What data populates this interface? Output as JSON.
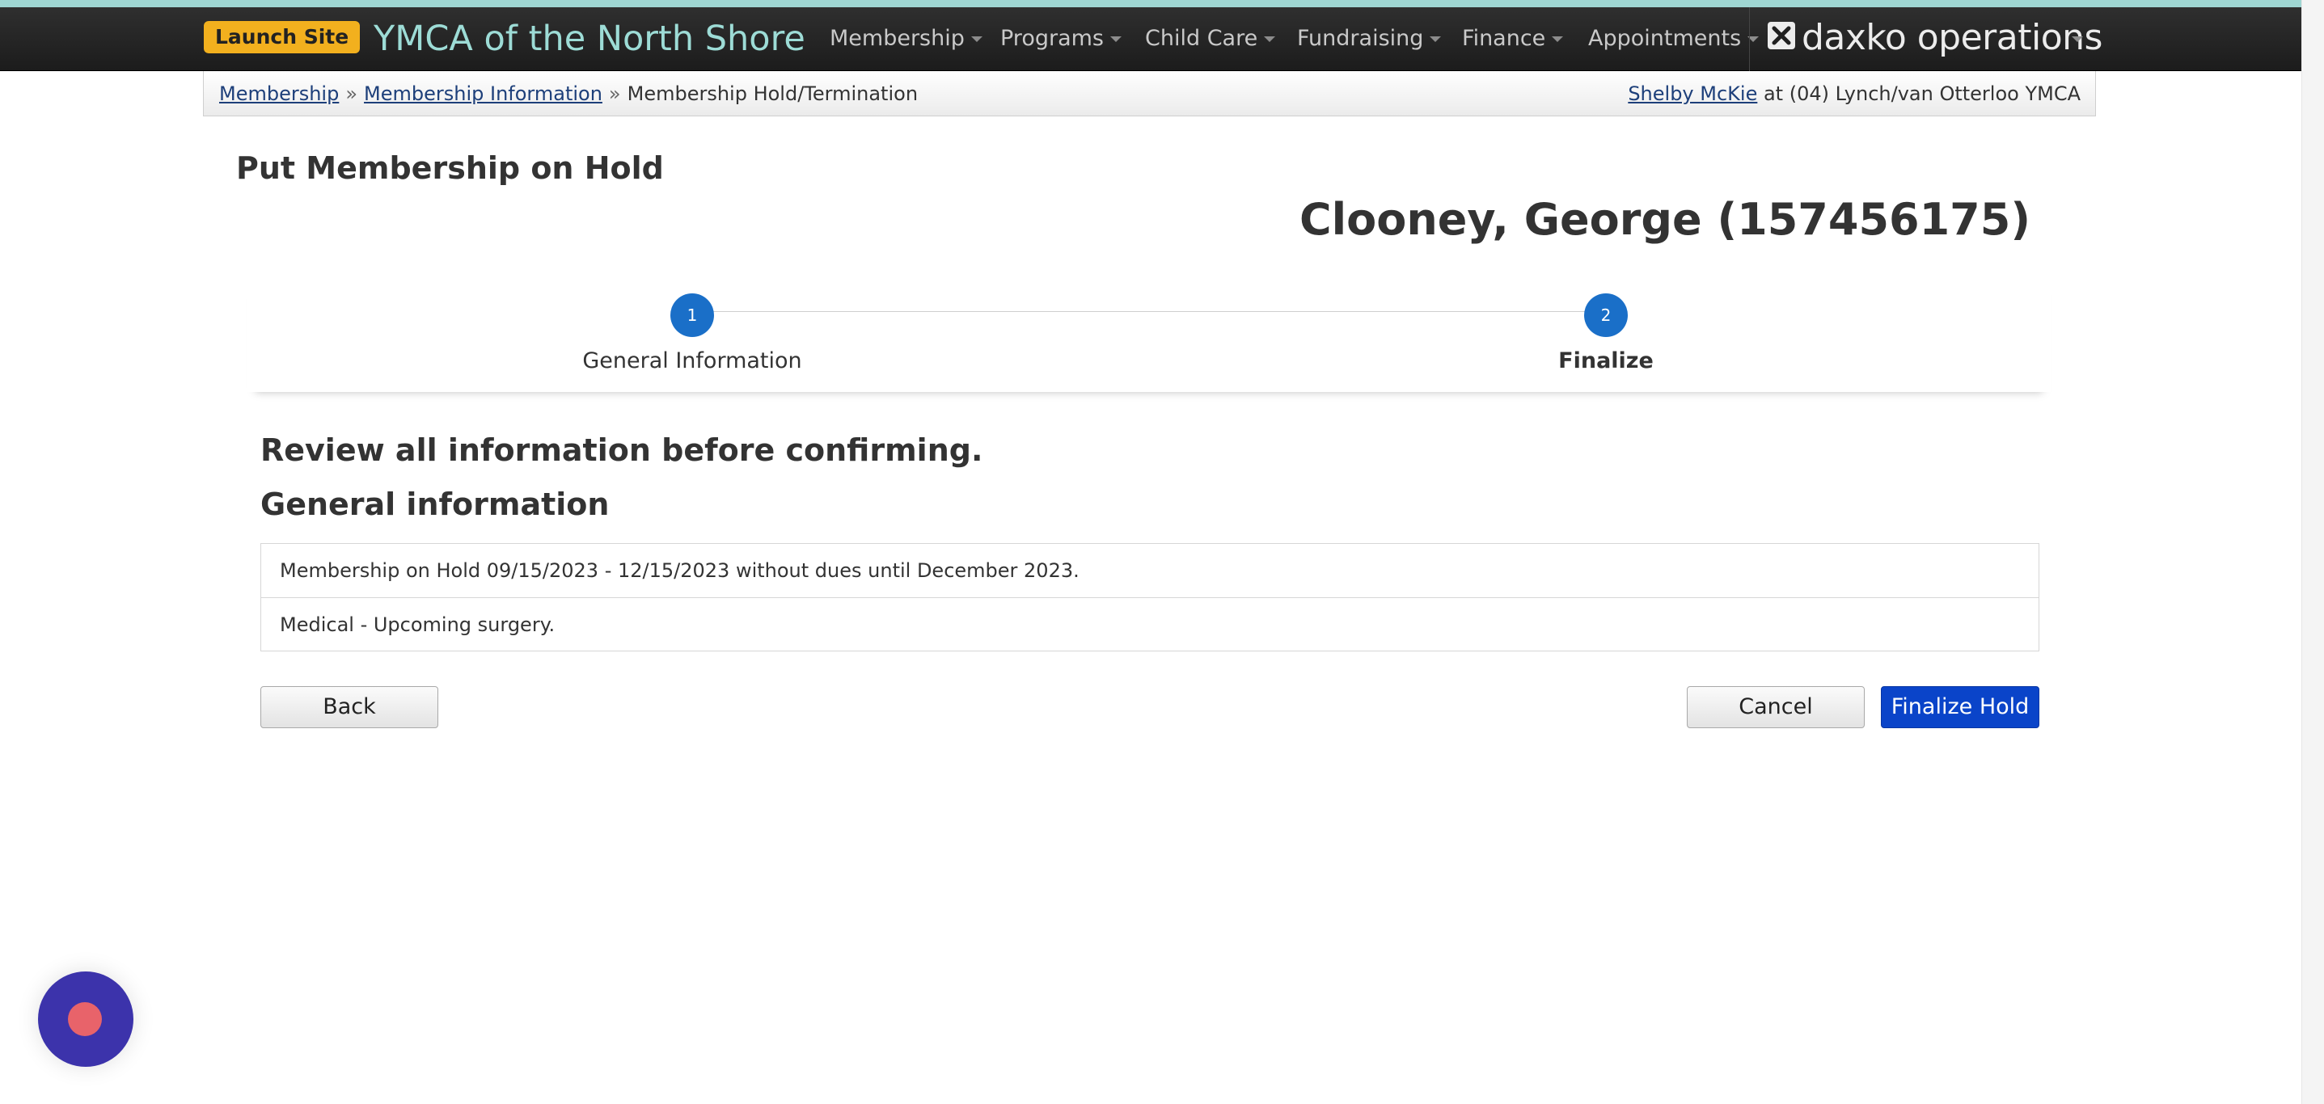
{
  "header": {
    "launch_label": "Launch Site",
    "brand": "YMCA of the North Shore",
    "nav": [
      {
        "label": "Membership"
      },
      {
        "label": "Programs"
      },
      {
        "label": "Child Care"
      },
      {
        "label": "Fundraising"
      },
      {
        "label": "Finance"
      },
      {
        "label": "Appointments"
      }
    ],
    "product_logo": "daxko operations"
  },
  "breadcrumb": {
    "items": [
      "Membership",
      "Membership Information",
      "Membership Hold/Termination"
    ],
    "separator": "»"
  },
  "user": {
    "name": "Shelby McKie",
    "location": " at (04) Lynch/van Otterloo YMCA"
  },
  "page": {
    "title": "Put Membership on Hold",
    "member": "Clooney, George (157456175)"
  },
  "steps": [
    {
      "number": "1",
      "label": "General Information",
      "active": false
    },
    {
      "number": "2",
      "label": "Finalize",
      "active": true
    }
  ],
  "review": {
    "heading": "Review all information before confirming.",
    "section_heading": "General information",
    "rows": [
      "Membership on Hold 09/15/2023 - 12/15/2023 without dues until December 2023.",
      "Medical - Upcoming surgery."
    ]
  },
  "actions": {
    "back": "Back",
    "cancel": "Cancel",
    "finalize": "Finalize Hold"
  },
  "colors": {
    "accent": "#1a6fc8",
    "primary_button": "#0a44c9",
    "launch": "#f2b01e",
    "brand_text": "#9ddcd6",
    "chat_widget": "#3c33ab"
  }
}
